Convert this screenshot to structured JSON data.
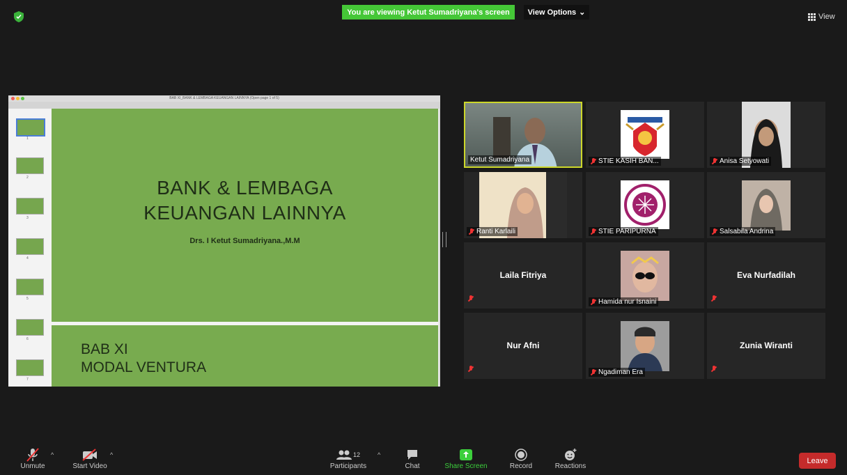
{
  "top": {
    "banner": "You are viewing Ketut Sumadriyana's screen",
    "view_options": "View Options",
    "view_options_caret": "⌄",
    "view": "View"
  },
  "shared_screen": {
    "doc_title": "BAB XI_BANK & LEMBAGA KEUANGAN LAINNYA (Open page 1 of 5)",
    "slide1": {
      "title_line1": "BANK & LEMBAGA",
      "title_line2": "KEUANGAN LAINNYA",
      "subtitle": "Drs. I Ketut Sumadriyana.,M.M"
    },
    "slide2": {
      "title_line1": "BAB XI",
      "title_line2": "MODAL VENTURA"
    },
    "thumb_numbers": [
      "1",
      "2",
      "3",
      "4",
      "5",
      "6",
      "7"
    ]
  },
  "gallery": [
    {
      "name": "Ketut Sumadriyana",
      "kind": "video",
      "muted": false,
      "active": true
    },
    {
      "name": "STIE KASIH BAN...",
      "kind": "logo",
      "muted": true,
      "active": false
    },
    {
      "name": "Anisa Setyowati",
      "kind": "photo",
      "muted": true,
      "active": false
    },
    {
      "name": "Ranti Karlaili",
      "kind": "photo",
      "muted": true,
      "active": false
    },
    {
      "name": "STIE PARIPURNA",
      "kind": "logo",
      "muted": true,
      "active": false
    },
    {
      "name": "Salsabila Andrina",
      "kind": "photo",
      "muted": true,
      "active": false
    },
    {
      "name": "Laila Fitriya",
      "kind": "name",
      "muted": true,
      "active": false
    },
    {
      "name": "Hamida nur Isnaini",
      "kind": "photo",
      "muted": true,
      "active": false
    },
    {
      "name": "Eva Nurfadilah",
      "kind": "name",
      "muted": true,
      "active": false
    },
    {
      "name": "Nur Afni",
      "kind": "name",
      "muted": true,
      "active": false
    },
    {
      "name": "Ngadiman Era",
      "kind": "photo",
      "muted": true,
      "active": false
    },
    {
      "name": "Zunia Wiranti",
      "kind": "name",
      "muted": true,
      "active": false
    }
  ],
  "toolbar": {
    "unmute": "Unmute",
    "start_video": "Start Video",
    "participants": "Participants",
    "participants_count": "12",
    "chat": "Chat",
    "share_screen": "Share Screen",
    "record": "Record",
    "reactions": "Reactions",
    "leave": "Leave",
    "caret": "^"
  },
  "colors": {
    "banner_green": "#45c737",
    "slide_green": "#78ab4f",
    "active_border": "#cdd72a",
    "muted_red": "#e33333",
    "leave_red": "#c52b2b"
  }
}
